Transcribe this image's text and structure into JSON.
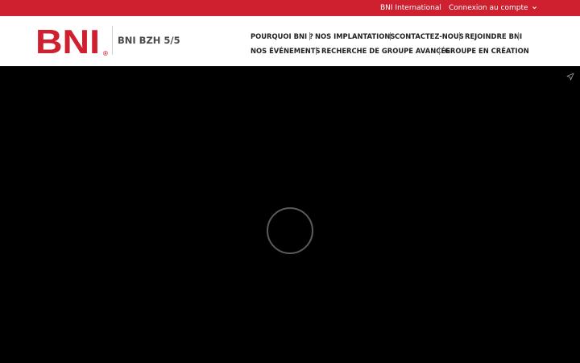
{
  "topbar": {
    "international_label": "BNI International",
    "login_label": "Connexion au compte",
    "chevron_icon": "chevron-down-icon"
  },
  "header": {
    "logo_text": "BNI",
    "registered_mark": "®",
    "chapter_name": "BNI BZH 5/5",
    "nav": [
      {
        "label": "POURQUOI BNI ?"
      },
      {
        "label": "NOS IMPLANTATIONS"
      },
      {
        "label": "CONTACTEZ-NOUS"
      },
      {
        "label": "REJOINDRE BNI"
      },
      {
        "label": "NOS ÉVÉNEMENTS"
      },
      {
        "label": "RECHERCHE DE GROUPE AVANCÉE"
      },
      {
        "label": "GROUPE EN CRÉATION"
      }
    ]
  },
  "video": {
    "state": "loading",
    "share_icon": "paper-plane-icon"
  },
  "colors": {
    "brand_red": "#cf2030",
    "header_bg": "#ffffff",
    "nav_text": "#222222",
    "video_bg": "#000000"
  }
}
